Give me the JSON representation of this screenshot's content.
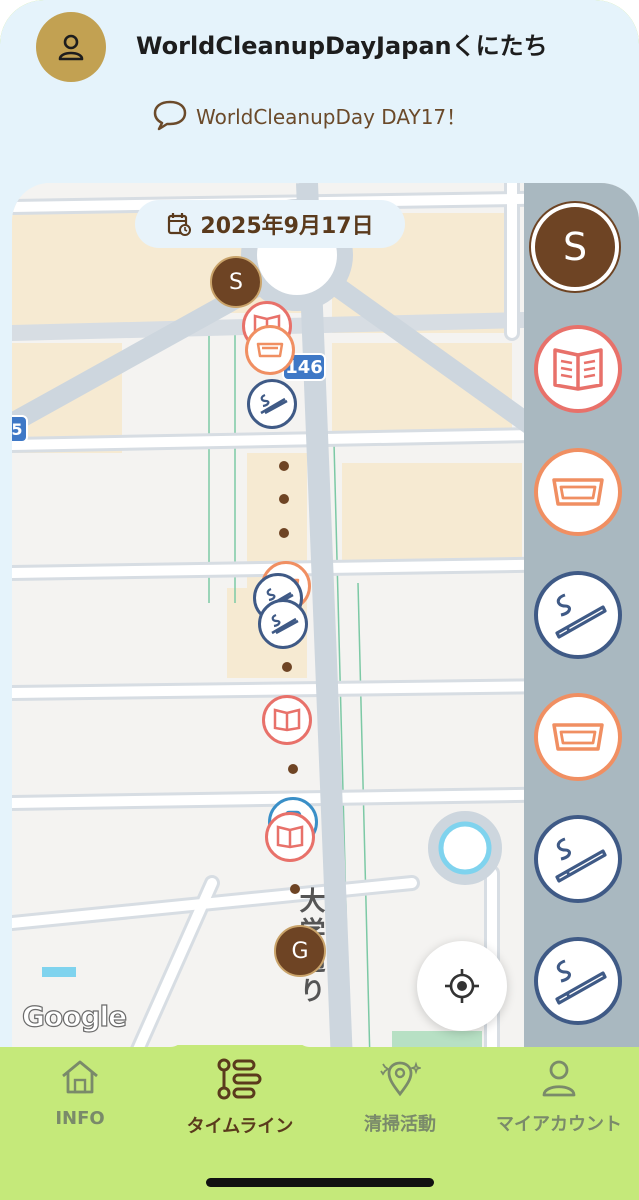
{
  "header": {
    "title": "WorldCleanupDayJapanくにたち",
    "avatar_icon": "user-icon",
    "subtitle": "WorldCleanupDay DAY17！",
    "subtitle_icon": "speech-bubble-icon"
  },
  "map": {
    "date_label": "2025年9月17日",
    "date_icon": "calendar-clock-icon",
    "route_badge": "146",
    "route_badge_partial": "5",
    "street_label": "大学通り",
    "attribution": "Google",
    "locate_icon": "locate-crosshair-icon",
    "start_marker": "S",
    "goal_marker": "G"
  },
  "rail": {
    "items": [
      {
        "kind": "start",
        "label": "S"
      },
      {
        "kind": "magazine",
        "icon": "magazine-icon"
      },
      {
        "kind": "container",
        "icon": "food-tray-icon"
      },
      {
        "kind": "cigarette",
        "icon": "cigarette-icon"
      },
      {
        "kind": "container",
        "icon": "food-tray-icon"
      },
      {
        "kind": "cigarette",
        "icon": "cigarette-icon"
      },
      {
        "kind": "cigarette",
        "icon": "cigarette-icon"
      }
    ]
  },
  "nav": {
    "items": [
      {
        "label": "INFO",
        "icon": "home-icon",
        "active": false
      },
      {
        "label": "タイムライン",
        "icon": "timeline-icon",
        "active": true
      },
      {
        "label": "清掃活動",
        "icon": "location-sparkle-icon",
        "active": false
      },
      {
        "label": "マイアカウント",
        "icon": "person-icon",
        "active": false
      }
    ]
  },
  "colors": {
    "brown": "#6e4424",
    "gold": "#c2a152",
    "red": "#e8716a",
    "orange": "#f08f62",
    "navy": "#3f5a86",
    "blue": "#3a8fc7",
    "nav_green": "#c5e97a",
    "nav_inactive": "#7a8a6a",
    "nav_active": "#5a3a1c"
  }
}
